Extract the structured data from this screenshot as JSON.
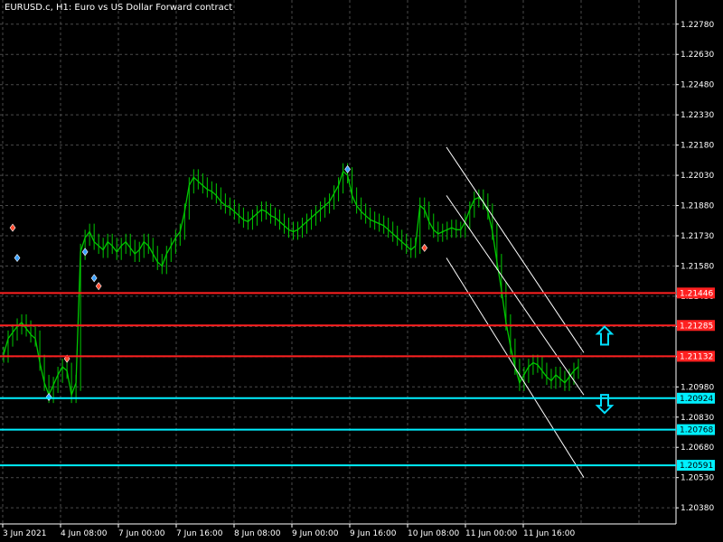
{
  "title": "EURUSD.c, H1:  Euro vs US Dollar Forward contract",
  "colors": {
    "background": "#000000",
    "grid": "#4a4a4a",
    "candle": "#00c800",
    "resistance": "#ff2020",
    "support": "#00f0ff",
    "channel": "#ffffff",
    "arrow_up": "#00e0ff",
    "arrow_down": "#00e0ff"
  },
  "chart_data": {
    "type": "line",
    "symbol": "EURUSD.c",
    "timeframe": "H1",
    "ylim": [
      1.203,
      1.229
    ],
    "grid": true,
    "y_ticks": [
      "1.22780",
      "1.22630",
      "1.22480",
      "1.22330",
      "1.22180",
      "1.22030",
      "1.21880",
      "1.21730",
      "1.21580",
      "1.21430",
      "1.21280",
      "1.21130",
      "1.20980",
      "1.20830",
      "1.20680",
      "1.20530",
      "1.20380"
    ],
    "x_ticks": [
      "3 Jun 2021",
      "4 Jun 08:00",
      "7 Jun 00:00",
      "7 Jun 16:00",
      "8 Jun 08:00",
      "9 Jun 00:00",
      "9 Jun 16:00",
      "10 Jun 08:00",
      "11 Jun 00:00",
      "11 Jun 16:00"
    ],
    "price_series": {
      "name": "EURUSD.c",
      "values": [
        1.2114,
        1.2122,
        1.2125,
        1.2128,
        1.213,
        1.2127,
        1.2124,
        1.2122,
        1.211,
        1.21,
        1.2094,
        1.2099,
        1.2104,
        1.2108,
        1.2106,
        1.2094,
        1.21,
        1.2165,
        1.2172,
        1.2175,
        1.217,
        1.2168,
        1.2166,
        1.217,
        1.2168,
        1.2165,
        1.2168,
        1.217,
        1.2167,
        1.2164,
        1.2166,
        1.217,
        1.2168,
        1.2164,
        1.216,
        1.2158,
        1.2164,
        1.2168,
        1.2172,
        1.2175,
        1.2185,
        1.2198,
        1.2202,
        1.22,
        1.2198,
        1.2196,
        1.2195,
        1.2193,
        1.219,
        1.2188,
        1.2187,
        1.2185,
        1.2183,
        1.2181,
        1.218,
        1.2182,
        1.2184,
        1.2186,
        1.2185,
        1.2183,
        1.2182,
        1.218,
        1.2178,
        1.2176,
        1.2175,
        1.2176,
        1.2178,
        1.218,
        1.2182,
        1.2184,
        1.2186,
        1.2188,
        1.219,
        1.2194,
        1.2198,
        1.2205,
        1.2203,
        1.2193,
        1.2188,
        1.2185,
        1.2183,
        1.2181,
        1.218,
        1.2179,
        1.2178,
        1.2176,
        1.2174,
        1.2172,
        1.217,
        1.2168,
        1.2166,
        1.2168,
        1.2188,
        1.2186,
        1.218,
        1.2176,
        1.2174,
        1.2175,
        1.2176,
        1.2177,
        1.2176,
        1.2176,
        1.218,
        1.2186,
        1.2191,
        1.2192,
        1.219,
        1.2185,
        1.2175,
        1.216,
        1.2146,
        1.213,
        1.2118,
        1.2108,
        1.21,
        1.2104,
        1.2108,
        1.211,
        1.2109,
        1.2106,
        1.2103,
        1.2101,
        1.2104,
        1.2102,
        1.21,
        1.2103,
        1.2106,
        1.2108
      ]
    },
    "levels": [
      {
        "value": 1.21446,
        "label": "1.21446",
        "kind": "resistance"
      },
      {
        "value": 1.21285,
        "label": "1.21285",
        "kind": "resistance"
      },
      {
        "value": 1.21132,
        "label": "1.21132",
        "kind": "resistance"
      },
      {
        "value": 1.20924,
        "label": "1.20924",
        "kind": "support"
      },
      {
        "value": 1.20768,
        "label": "1.20768",
        "kind": "support"
      },
      {
        "value": 1.20591,
        "label": "1.20591",
        "kind": "support"
      }
    ],
    "channel_lines": [
      {
        "x": [
          "9 Jun 19:00",
          "11 Jun 21:00"
        ],
        "y": [
          1.2217,
          1.2115
        ]
      },
      {
        "x": [
          "9 Jun 19:00",
          "11 Jun 21:00"
        ],
        "y": [
          1.2193,
          1.2094
        ]
      },
      {
        "x": [
          "9 Jun 19:00",
          "11 Jun 21:00"
        ],
        "y": [
          1.2162,
          1.2053
        ]
      }
    ],
    "markers": [
      {
        "index": 2,
        "value": 1.2177,
        "kind": "sell"
      },
      {
        "index": 3,
        "value": 1.2162,
        "kind": "buy"
      },
      {
        "index": 10,
        "value": 1.2093,
        "kind": "buy"
      },
      {
        "index": 14,
        "value": 1.2112,
        "kind": "sell"
      },
      {
        "index": 18,
        "value": 1.2165,
        "kind": "buy"
      },
      {
        "index": 20,
        "value": 1.2152,
        "kind": "buy"
      },
      {
        "index": 21,
        "value": 1.2148,
        "kind": "sell"
      },
      {
        "index": 76,
        "value": 1.2206,
        "kind": "buy"
      },
      {
        "index": 93,
        "value": 1.2167,
        "kind": "sell"
      }
    ],
    "signal_arrows": [
      {
        "direction": "up",
        "value": 1.2123
      },
      {
        "direction": "down",
        "value": 1.209
      }
    ]
  }
}
